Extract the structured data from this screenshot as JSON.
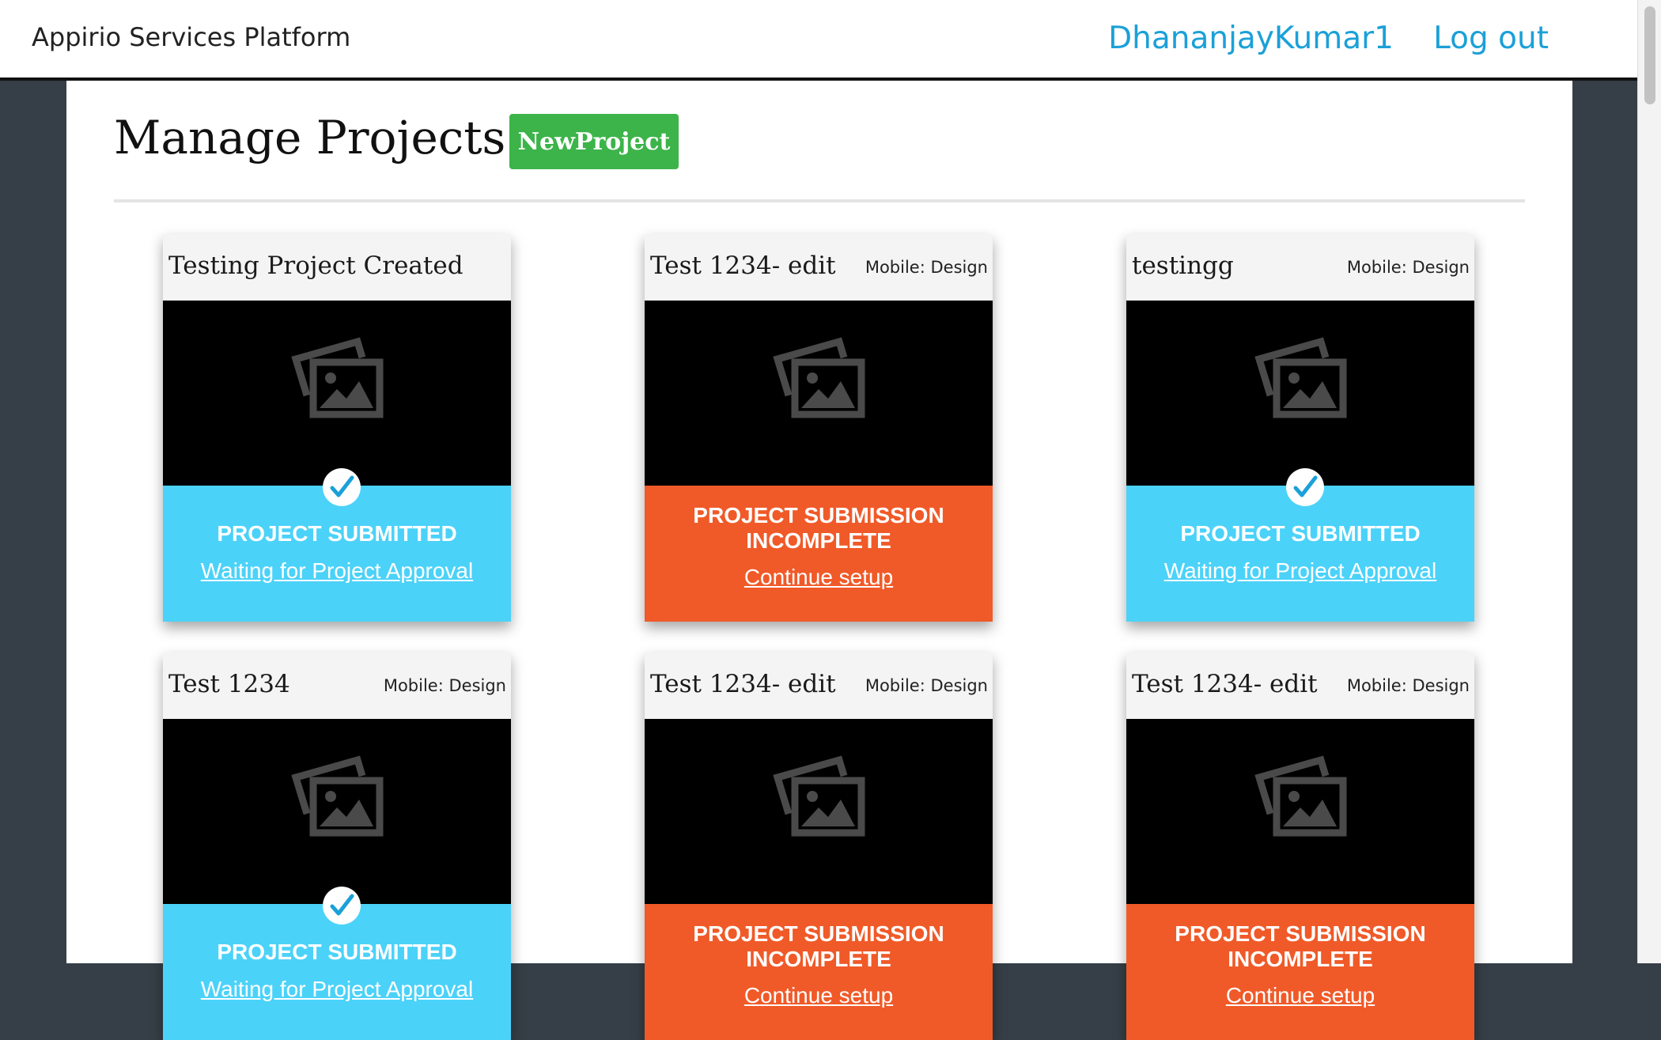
{
  "header": {
    "brand": "Appirio Services Platform",
    "username": "DhananjayKumar1",
    "logout": "Log out"
  },
  "page": {
    "title": "Manage Projects",
    "new_project_label": "NewProject"
  },
  "projects": [
    {
      "name": "Testing Project Created",
      "type": "",
      "status": "submitted",
      "status_title": "PROJECT SUBMITTED",
      "status_link": "Waiting for Project Approval"
    },
    {
      "name": "Test 1234- edit",
      "type": "Mobile: Design",
      "status": "incomplete",
      "status_title": "PROJECT SUBMISSION INCOMPLETE",
      "status_link": "Continue setup"
    },
    {
      "name": "testingg",
      "type": "Mobile: Design",
      "status": "submitted",
      "status_title": "PROJECT SUBMITTED",
      "status_link": "Waiting for Project Approval"
    },
    {
      "name": "Test 1234",
      "type": "Mobile: Design",
      "status": "submitted",
      "status_title": "PROJECT SUBMITTED",
      "status_link": "Waiting for Project Approval"
    },
    {
      "name": "Test 1234- edit",
      "type": "Mobile: Design",
      "status": "incomplete",
      "status_title": "PROJECT SUBMISSION INCOMPLETE",
      "status_link": "Continue setup"
    },
    {
      "name": "Test 1234- edit",
      "type": "Mobile: Design",
      "status": "incomplete",
      "status_title": "PROJECT SUBMISSION INCOMPLETE",
      "status_link": "Continue setup"
    }
  ],
  "colors": {
    "submitted": "#4bd2f9",
    "incomplete": "#f05a28",
    "accent_link": "#1ba0d8",
    "new_button": "#3cb44a"
  },
  "icons": {
    "placeholder": "image-placeholder-icon",
    "check": "check-circle-icon"
  }
}
